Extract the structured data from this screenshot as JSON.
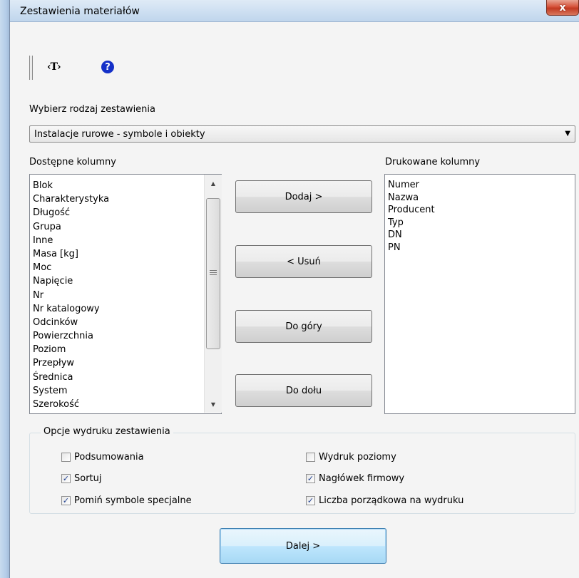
{
  "window": {
    "title": "Zestawienia materiałów",
    "close_glyph": "x"
  },
  "toolbar": {
    "tag_button_label": "‹T›",
    "help_glyph": "?"
  },
  "report_type": {
    "label": "Wybierz rodzaj zestawienia",
    "selected": "Instalacje rurowe - symbole i obiekty"
  },
  "available": {
    "label": "Dostępne kolumny",
    "items": [
      "Blok",
      "Charakterystyka",
      "Długość",
      "Grupa",
      "Inne",
      "Masa [kg]",
      "Moc",
      "Napięcie",
      "Nr",
      "Nr katalogowy",
      "Odcinków",
      "Powierzchnia",
      "Poziom",
      "Przepływ",
      "Średnica",
      "System",
      "Szerokość"
    ]
  },
  "printed": {
    "label": "Drukowane kolumny",
    "items": [
      "Numer",
      "Nazwa",
      "Producent",
      "Typ",
      "DN",
      "PN"
    ]
  },
  "buttons": {
    "add": "Dodaj >",
    "remove": "< Usuń",
    "move_up": "Do góry",
    "move_down": "Do dołu",
    "next": "Dalej >"
  },
  "options": {
    "legend": "Opcje wydruku zestawienia",
    "items": [
      {
        "label": "Podsumowania",
        "checked": false
      },
      {
        "label": "Sortuj",
        "checked": true
      },
      {
        "label": "Pomiń symbole specjalne",
        "checked": true
      },
      {
        "label": "Wydruk poziomy",
        "checked": false
      },
      {
        "label": "Nagłówek firmowy",
        "checked": true
      },
      {
        "label": "Liczba porządkowa na wydruku",
        "checked": true
      }
    ]
  },
  "colors": {
    "help_icon": "#1430c8",
    "close_button": "#c8452c",
    "check_mark": "#1f3f8f"
  }
}
